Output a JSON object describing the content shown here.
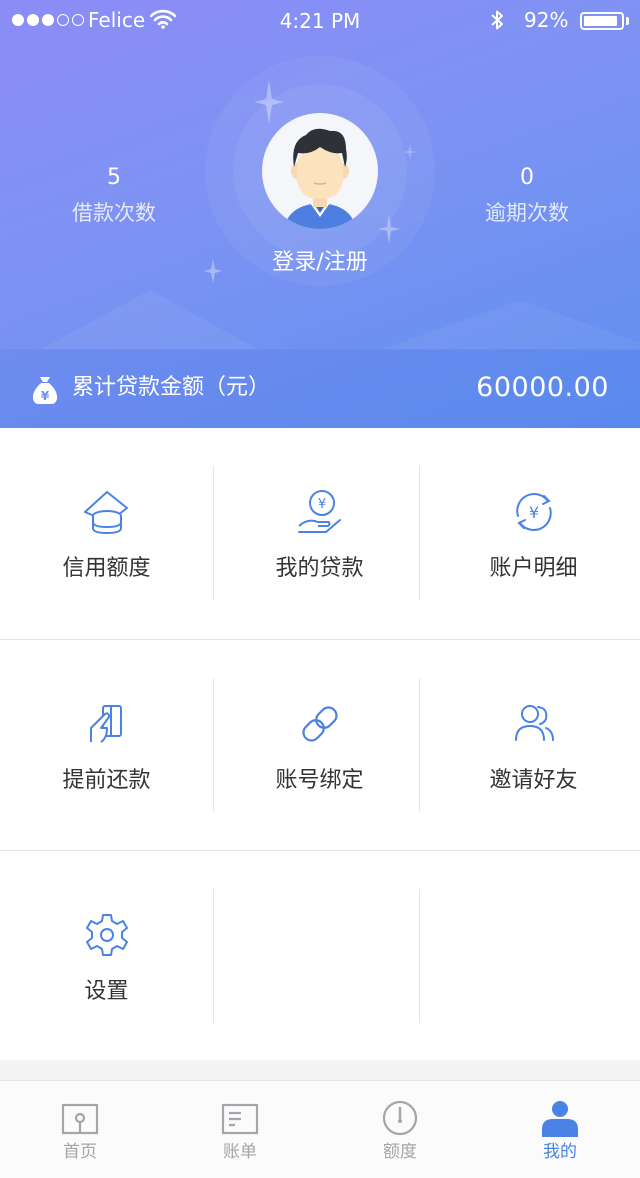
{
  "status_bar": {
    "carrier": "Felice",
    "time": "4:21 PM",
    "battery": "92%",
    "battery_level": 0.92,
    "signal_bars": 3,
    "signal_total": 5
  },
  "profile": {
    "borrow_count": "5",
    "borrow_count_label": "借款次数",
    "overdue_count": "0",
    "overdue_count_label": "逾期次数",
    "login_label": "登录/注册"
  },
  "loan_summary": {
    "label": "累计贷款金额（元）",
    "amount": "60000.00",
    "icon_glyph": "¥"
  },
  "menu": [
    {
      "label": "信用额度",
      "icon": "credit-limit-icon"
    },
    {
      "label": "我的贷款",
      "icon": "my-loan-icon",
      "glyph": "¥"
    },
    {
      "label": "账户明细",
      "icon": "account-detail-icon",
      "glyph": "¥"
    },
    {
      "label": "提前还款",
      "icon": "early-repay-icon"
    },
    {
      "label": "账号绑定",
      "icon": "link-icon"
    },
    {
      "label": "邀请好友",
      "icon": "invite-friends-icon"
    },
    {
      "label": "设置",
      "icon": "gear-icon"
    }
  ],
  "tabbar": {
    "items": [
      {
        "label": "首页",
        "icon": "home-icon"
      },
      {
        "label": "账单",
        "icon": "bill-icon"
      },
      {
        "label": "额度",
        "icon": "gauge-icon"
      },
      {
        "label": "我的",
        "icon": "person-icon"
      }
    ],
    "active_index": 3
  },
  "colors": {
    "accent": "#4a82e6",
    "header_gradient_start": "#8d8cf6",
    "header_gradient_end": "#5e8fef",
    "tab_inactive": "#a4a4aa"
  }
}
